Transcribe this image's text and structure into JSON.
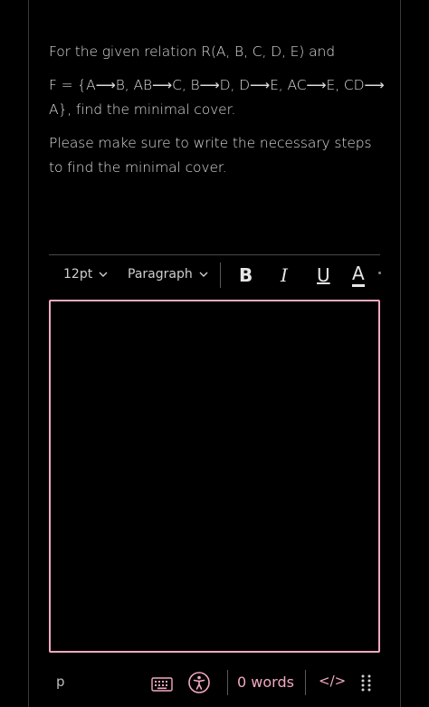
{
  "question": {
    "line1": "For the given relation R(A, B, C, D, E) and",
    "line2": "F = {A⟶B, AB⟶C, B⟶D, D⟶E, AC⟶E, CD⟶ A}, find the minimal cover.",
    "line3": "Please make sure to write the necessary steps to find the minimal cover."
  },
  "toolbar": {
    "font_size": "12pt",
    "block_format": "Paragraph",
    "bold_label": "B",
    "italic_label": "I",
    "underline_label": "U",
    "color_label": "A"
  },
  "editor": {
    "content": ""
  },
  "status": {
    "path": "p",
    "word_count": "0 words",
    "code_label": "</>"
  },
  "colors": {
    "accent": "#f2a9c1",
    "background": "#000000",
    "text": "#dcdcdc"
  },
  "icons": {
    "keyboard": "keyboard-icon",
    "accessibility": "accessibility-icon",
    "grip": "resize-grip-icon",
    "chevron": "chevron-down-icon"
  }
}
